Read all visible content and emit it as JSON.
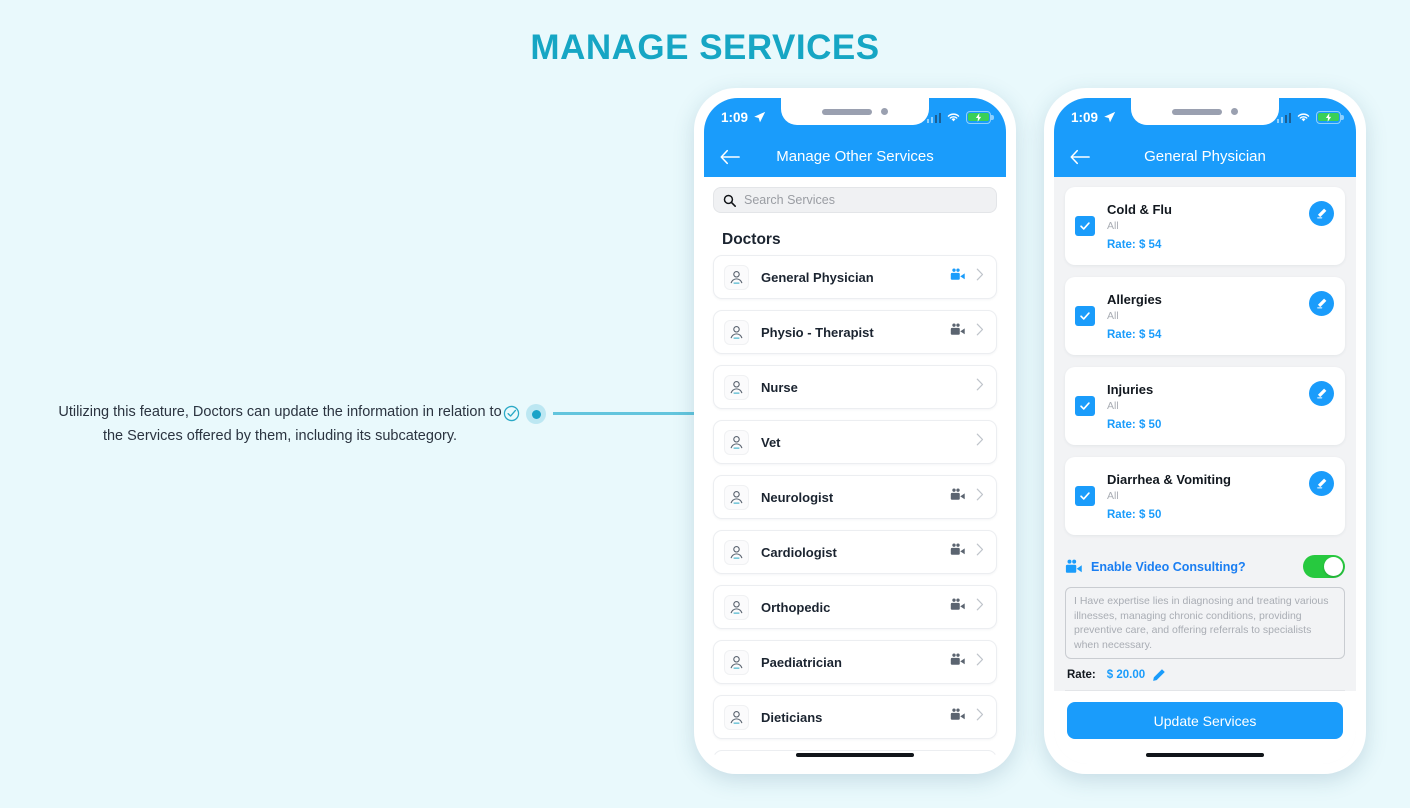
{
  "page": {
    "title": "MANAGE SERVICES",
    "title_color": "#16a6c4",
    "background": "#e9f9fc"
  },
  "annotation": {
    "line1": "Utilizing this feature, Doctors can update the information in relation to",
    "line2": "the Services offered by them, including its subcategory.",
    "marker_icon": "check-circle-icon",
    "dot_icon": "dot-marker-icon",
    "accent_color": "#1aa3c8"
  },
  "left_phone": {
    "status_bar": {
      "time": "1:09",
      "location_icon": "location-arrow-icon",
      "signal_icon": "signal-bars-icon",
      "wifi_icon": "wifi-icon",
      "battery_icon": "battery-charging-icon"
    },
    "header": {
      "back_icon": "back-arrow-icon",
      "title": "Manage Other Services"
    },
    "search": {
      "icon": "search-icon",
      "placeholder": "Search Services"
    },
    "section_title": "Doctors",
    "items": [
      {
        "label": "General Physician",
        "icon": "doctor-avatar-icon",
        "video": true,
        "video_active": true,
        "chevron": "chevron-right-icon"
      },
      {
        "label": "Physio - Therapist",
        "icon": "physio-icon",
        "video": true,
        "video_active": false,
        "chevron": "chevron-right-icon"
      },
      {
        "label": "Nurse",
        "icon": "nurse-icon",
        "video": false,
        "video_active": false,
        "chevron": "chevron-right-icon"
      },
      {
        "label": "Vet",
        "icon": "vet-paw-icon",
        "video": false,
        "video_active": false,
        "chevron": "chevron-right-icon"
      },
      {
        "label": "Neurologist",
        "icon": "neurologist-icon",
        "video": true,
        "video_active": false,
        "chevron": "chevron-right-icon"
      },
      {
        "label": "Cardiologist",
        "icon": "cardiologist-icon",
        "video": true,
        "video_active": false,
        "chevron": "chevron-right-icon"
      },
      {
        "label": "Orthopedic",
        "icon": "orthopedic-icon",
        "video": true,
        "video_active": false,
        "chevron": "chevron-right-icon"
      },
      {
        "label": "Paediatrician",
        "icon": "paediatrician-icon",
        "video": true,
        "video_active": false,
        "chevron": "chevron-right-icon"
      },
      {
        "label": "Dieticians",
        "icon": "dietician-icon",
        "video": true,
        "video_active": false,
        "chevron": "chevron-right-icon"
      }
    ]
  },
  "right_phone": {
    "status_bar": {
      "time": "1:09",
      "location_icon": "location-arrow-icon",
      "signal_icon": "signal-bars-icon",
      "wifi_icon": "wifi-icon",
      "battery_icon": "battery-charging-icon"
    },
    "header": {
      "back_icon": "back-arrow-icon",
      "title": "General Physician"
    },
    "service_cards": [
      {
        "title": "Cold & Flu",
        "subtitle": "All",
        "rate_label": "Rate:",
        "rate": "$ 54",
        "checked": true,
        "edit_icon": "edit-pencil-icon"
      },
      {
        "title": "Allergies",
        "subtitle": "All",
        "rate_label": "Rate:",
        "rate": "$ 54",
        "checked": true,
        "edit_icon": "edit-pencil-icon"
      },
      {
        "title": "Injuries",
        "subtitle": "All",
        "rate_label": "Rate:",
        "rate": "$ 50",
        "checked": true,
        "edit_icon": "edit-pencil-icon"
      },
      {
        "title": "Diarrhea & Vomiting",
        "subtitle": "All",
        "rate_label": "Rate:",
        "rate": "$ 50",
        "checked": true,
        "edit_icon": "edit-pencil-icon"
      }
    ],
    "video_consulting": {
      "icon": "video-camera-icon",
      "label": "Enable Video Consulting?",
      "toggle_on": true,
      "toggle_color": "#27c93f"
    },
    "description_placeholder": "I Have expertise lies in diagnosing and treating various illnesses, managing chronic conditions, providing preventive care, and offering referrals to specialists when necessary.",
    "rate_row": {
      "label": "Rate:",
      "amount": "$ 20.00",
      "edit_icon": "edit-pencil-icon"
    },
    "update_button": "Update Services"
  },
  "colors": {
    "primary_blue": "#1a9cfb",
    "teal": "#16a6c4",
    "green": "#27c93f"
  }
}
